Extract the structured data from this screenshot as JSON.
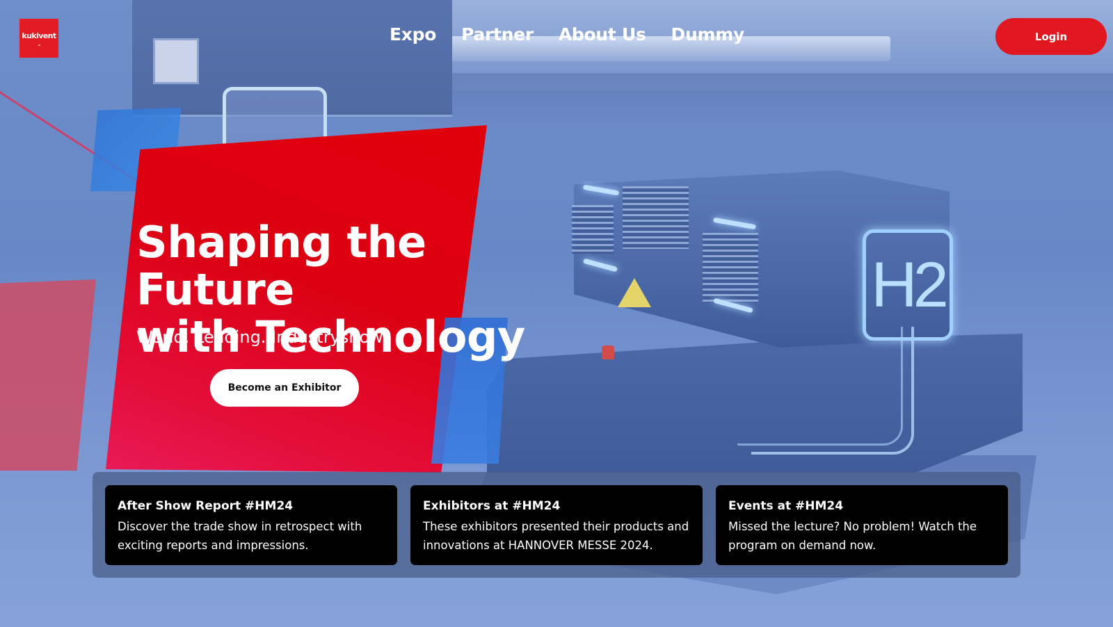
{
  "brand": {
    "logo_text": "kukivent",
    "color": "#e21c22"
  },
  "nav": {
    "items": [
      {
        "label": "Expo"
      },
      {
        "label": "Partner"
      },
      {
        "label": "About Us"
      },
      {
        "label": "Dummy"
      }
    ],
    "login_label": "Login"
  },
  "hero": {
    "title_line1": "Shaping the Future",
    "title_line2": "with Technology",
    "subtitle": "World. Leading. Industryshow.",
    "cta_label": "Become an Exhibitor",
    "background_text": "H2"
  },
  "cards": [
    {
      "title": "After Show Report #HM24",
      "text": "Discover the trade show in retrospect with exciting reports and impressions."
    },
    {
      "title": "Exhibitors at #HM24",
      "text": "These exhibitors presented their products and innovations at HANNOVER MESSE 2024."
    },
    {
      "title": "Events at #HM24",
      "text": "Missed the lecture? No problem! Watch the program on demand now."
    }
  ],
  "colors": {
    "accent_red": "#e0171f",
    "overlay_blue": "#6f8fca",
    "card_bg": "#000000"
  }
}
